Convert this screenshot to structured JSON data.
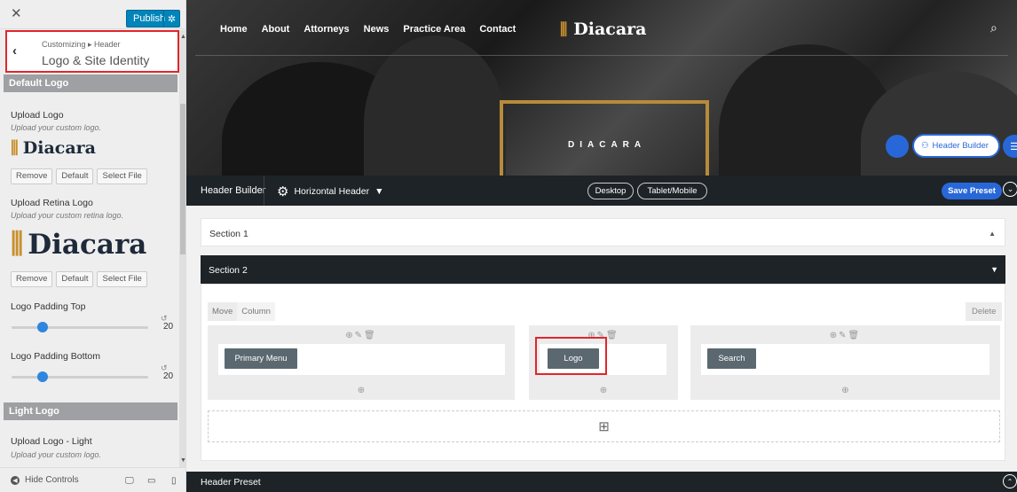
{
  "sidebar": {
    "publish_label": "Publish",
    "breadcrumb": "Customizing ▸ Header",
    "title": "Logo & Site Identity",
    "sections": {
      "default_logo": "Default Logo",
      "light_logo": "Light Logo"
    },
    "upload_logo": {
      "label": "Upload Logo",
      "desc": "Upload your custom logo."
    },
    "upload_retina": {
      "label": "Upload Retina Logo",
      "desc": "Upload your custom retina logo."
    },
    "upload_light": {
      "label": "Upload Logo - Light",
      "desc": "Upload your custom logo."
    },
    "buttons": {
      "remove": "Remove",
      "default": "Default",
      "select_file": "Select File"
    },
    "logo_text": "Diacara",
    "padding_top": {
      "label": "Logo Padding Top",
      "value": "20",
      "slider_fraction": 0.23
    },
    "padding_bottom": {
      "label": "Logo Padding Bottom",
      "value": "20",
      "slider_fraction": 0.23
    },
    "footer": {
      "hide_controls": "Hide Controls"
    }
  },
  "preview": {
    "nav": [
      "Home",
      "About",
      "Attorneys",
      "News",
      "Practice Area",
      "Contact"
    ],
    "brand": "Diacara",
    "hero_text": "DIACARA",
    "header_builder_pill": "Header Builder"
  },
  "builder": {
    "title": "Header Builder",
    "type": "Horizontal Header",
    "desktop": "Desktop",
    "tablet": "Tablet/Mobile",
    "save_preset": "Save Preset",
    "section1": "Section 1",
    "section2": "Section 2",
    "move": "Move",
    "column": "Column",
    "delete": "Delete",
    "elements": {
      "primary_menu": "Primary Menu",
      "logo": "Logo",
      "search": "Search"
    },
    "header_preset": "Header Preset"
  },
  "colors": {
    "accent": "#2867d8",
    "wp_blue": "#0085ba",
    "highlight": "#e0262c",
    "gold": "#c8902e",
    "dark": "#1d2327"
  }
}
